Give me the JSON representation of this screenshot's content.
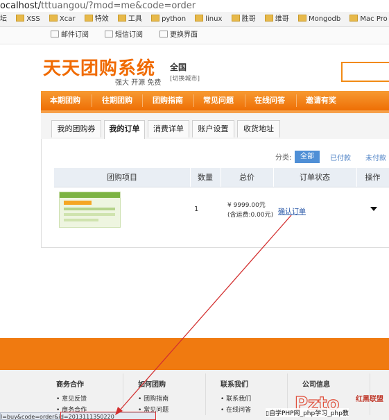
{
  "browser": {
    "address_prefix": "ocalhost/",
    "address_rest": "tttuangou/?mod=me&code=order",
    "bookmarks": [
      "坛",
      "XSS",
      "Xcar",
      "特效",
      "工具",
      "python",
      "linux",
      "胜哥",
      "维哥",
      "Mongodb",
      "Mac Pro"
    ],
    "status_url": "l=buy&code=order&id=2013111350220"
  },
  "toplinks": [
    "邮件订阅",
    "短信订阅",
    "更换界面"
  ],
  "header": {
    "logo": "天天团购系统",
    "slogan": "强大 开源 免费",
    "city": "全国",
    "city_change": "[切换城市]"
  },
  "nav": [
    "本期团购",
    "往期团购",
    "团购指南",
    "常见问题",
    "在线问答",
    "邀请有奖"
  ],
  "tabs": [
    "我的团购券",
    "我的订单",
    "消费详单",
    "账户设置",
    "收货地址"
  ],
  "active_tab": "我的订单",
  "filters": {
    "label": "分类:",
    "all": "全部",
    "paid": "已付款",
    "unpaid": "未付款"
  },
  "table": {
    "headers": [
      "团购项目",
      "数量",
      "总价",
      "订单状态",
      "操作"
    ],
    "rows": [
      {
        "qty": "1",
        "price": "¥ 9999.00元",
        "shipping": "(含运费:0.00元)",
        "status": "确认订单"
      }
    ]
  },
  "footer": {
    "columns": [
      {
        "title": "商务合作",
        "items": [
          "意见反馈",
          "商务合作"
        ]
      },
      {
        "title": "如何团购",
        "items": [
          "团购指南",
          "常见问题"
        ]
      },
      {
        "title": "联系我们",
        "items": [
          "联系我们",
          "在线问答"
        ]
      },
      {
        "title": "公司信息",
        "items": []
      }
    ]
  },
  "watermark": {
    "text": "自学PHP网_php学习_php教",
    "red": "红黑联盟"
  },
  "colors": {
    "orange": "#f07a10",
    "blue": "#4f8fd6",
    "logo": "#f06a00"
  }
}
